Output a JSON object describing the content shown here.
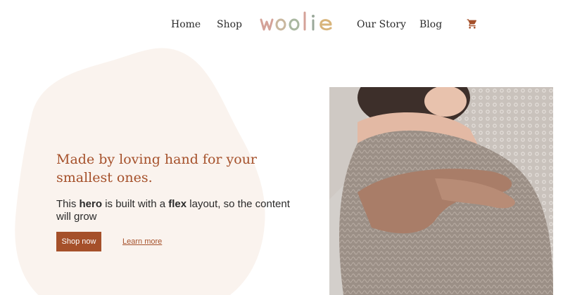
{
  "nav": {
    "items": [
      {
        "label": "Home"
      },
      {
        "label": "Shop"
      },
      {
        "label": "Our Story"
      },
      {
        "label": "Blog"
      }
    ],
    "cart_icon": "shopping-cart-icon"
  },
  "logo": {
    "text": "woolie",
    "letter_colors": [
      "#d4a298",
      "#c9b79e",
      "#a9b7a0",
      "#d4a298",
      "#9aa89a",
      "#d8b47a"
    ]
  },
  "hero": {
    "heading": "Made by loving hand for your smallest ones.",
    "text_parts": {
      "part1": "This ",
      "bold1": "hero",
      "part2": " is built with a ",
      "bold2": "flex",
      "part3": " layout, so the content will grow"
    },
    "primary_button": "Shop now",
    "secondary_link": "Learn more",
    "image_alt": "baby wrapped in knitted blanket held by parent"
  },
  "colors": {
    "accent": "#a5502a",
    "blob": "#faf3ee",
    "text": "#2a2a2a"
  }
}
